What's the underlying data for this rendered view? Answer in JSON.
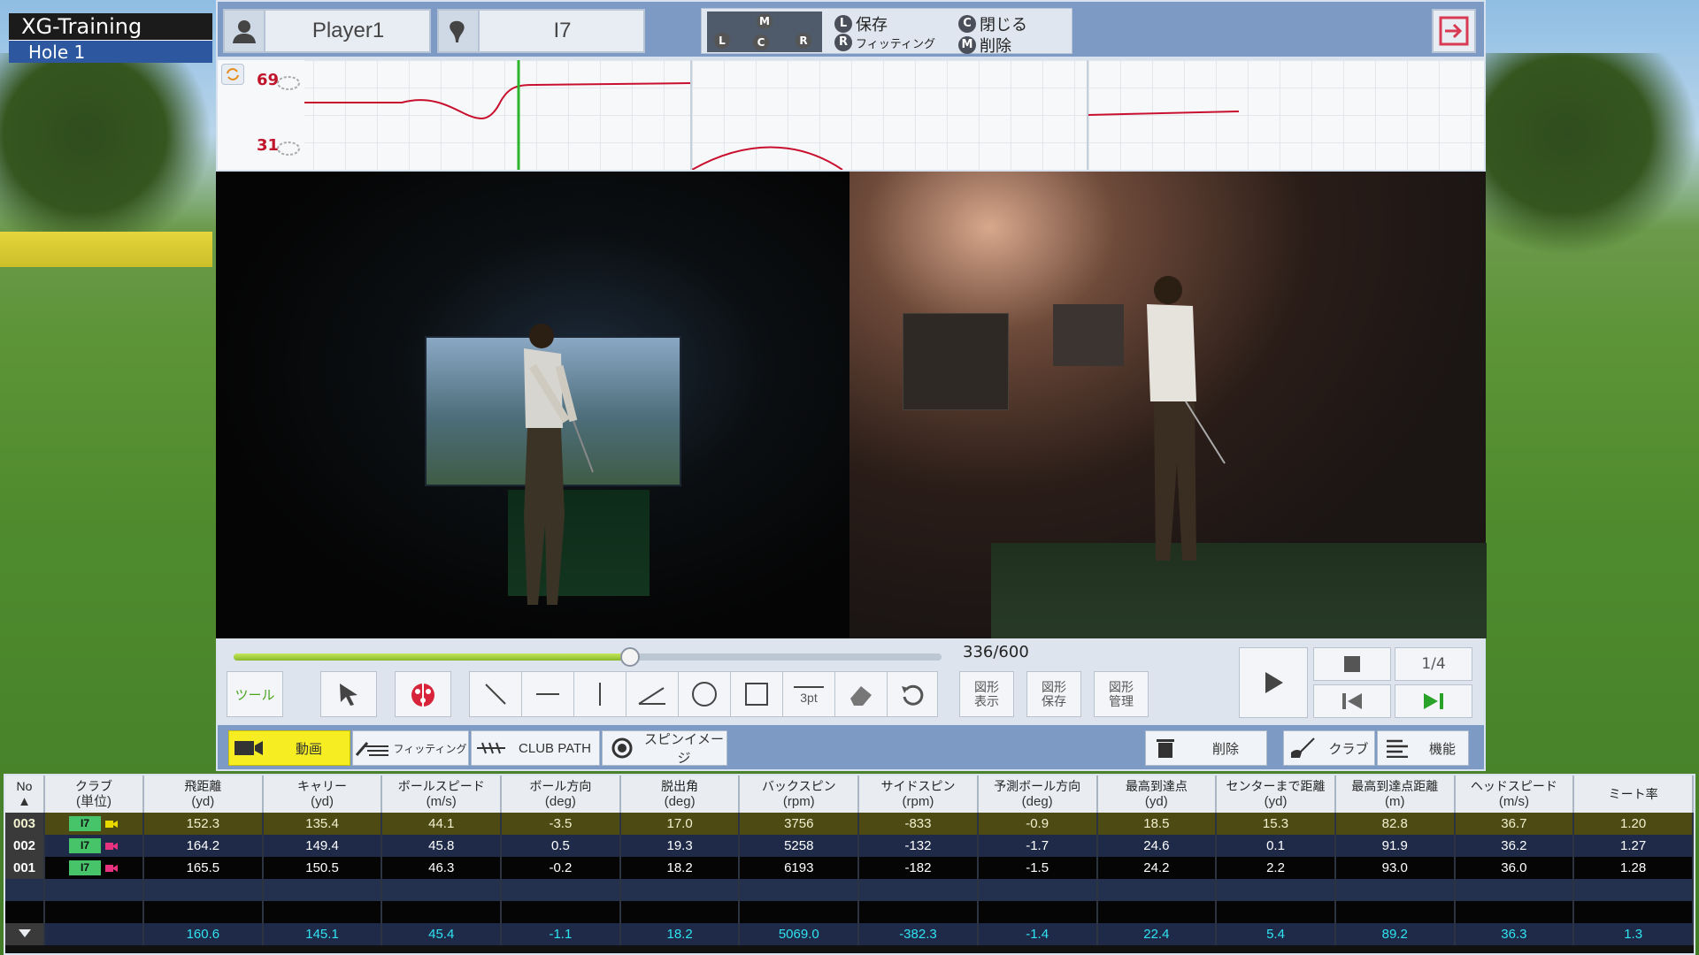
{
  "app": {
    "title": "XG-Training",
    "hole": "Hole 1"
  },
  "header": {
    "player": "Player1",
    "club": "I7",
    "legend": {
      "figure_labels": [
        "M",
        "L",
        "C",
        "R"
      ],
      "items": [
        {
          "key": "L",
          "label": "保存"
        },
        {
          "key": "C",
          "label": "閉じる"
        },
        {
          "key": "R",
          "label": "フィッティング"
        },
        {
          "key": "M",
          "label": "削除"
        }
      ]
    }
  },
  "graphs": {
    "left_top": "69",
    "left_bottom": "31"
  },
  "playback": {
    "frame": "336/600",
    "progress": 0.56,
    "speed": "1/4"
  },
  "tools": {
    "tool_label": "ツール",
    "thickness_label": "3pt",
    "shape_show": [
      "図形",
      "表示"
    ],
    "shape_save": [
      "図形",
      "保存"
    ],
    "shape_manage": [
      "図形",
      "管理"
    ]
  },
  "modes": {
    "video": "動画",
    "fitting": "フィッティング",
    "clubpath": "CLUB PATH",
    "spin": "スピンイメージ",
    "delete": "削除",
    "club": "クラブ",
    "function": "機能"
  },
  "table": {
    "headers": [
      {
        "t": "No",
        "u": "▲"
      },
      {
        "t": "クラブ",
        "u": "(単位)"
      },
      {
        "t": "飛距離",
        "u": "(yd)"
      },
      {
        "t": "キャリー",
        "u": "(yd)"
      },
      {
        "t": "ボールスピード",
        "u": "(m/s)"
      },
      {
        "t": "ボール方向",
        "u": "(deg)"
      },
      {
        "t": "脱出角",
        "u": "(deg)"
      },
      {
        "t": "バックスピン",
        "u": "(rpm)"
      },
      {
        "t": "サイドスピン",
        "u": "(rpm)"
      },
      {
        "t": "予測ボール方向",
        "u": "(deg)"
      },
      {
        "t": "最高到達点",
        "u": "(yd)"
      },
      {
        "t": "センターまで距離",
        "u": "(yd)"
      },
      {
        "t": "最高到達点距離",
        "u": "(m)"
      },
      {
        "t": "ヘッドスピード",
        "u": "(m/s)"
      },
      {
        "t": "ミート率",
        "u": ""
      }
    ],
    "rows": [
      {
        "no": "003",
        "club": "I7",
        "vals": [
          "152.3",
          "135.4",
          "44.1",
          "-3.5",
          "17.0",
          "3756",
          "-833",
          "-0.9",
          "18.5",
          "15.3",
          "82.8",
          "36.7",
          "1.20"
        ]
      },
      {
        "no": "002",
        "club": "I7",
        "vals": [
          "164.2",
          "149.4",
          "45.8",
          "0.5",
          "19.3",
          "5258",
          "-132",
          "-1.7",
          "24.6",
          "0.1",
          "91.9",
          "36.2",
          "1.27"
        ]
      },
      {
        "no": "001",
        "club": "I7",
        "vals": [
          "165.5",
          "150.5",
          "46.3",
          "-0.2",
          "18.2",
          "6193",
          "-182",
          "-1.5",
          "24.2",
          "2.2",
          "93.0",
          "36.0",
          "1.28"
        ]
      }
    ],
    "avg": [
      "160.6",
      "145.1",
      "45.4",
      "-1.1",
      "18.2",
      "5069.0",
      "-382.3",
      "-1.4",
      "22.4",
      "5.4",
      "89.2",
      "36.3",
      "1.3"
    ]
  },
  "colors": {
    "accent": "#f6ee23",
    "header": "#7d9ac4",
    "avg_text": "#30e3f2",
    "selected_row": "#4e4a13"
  }
}
